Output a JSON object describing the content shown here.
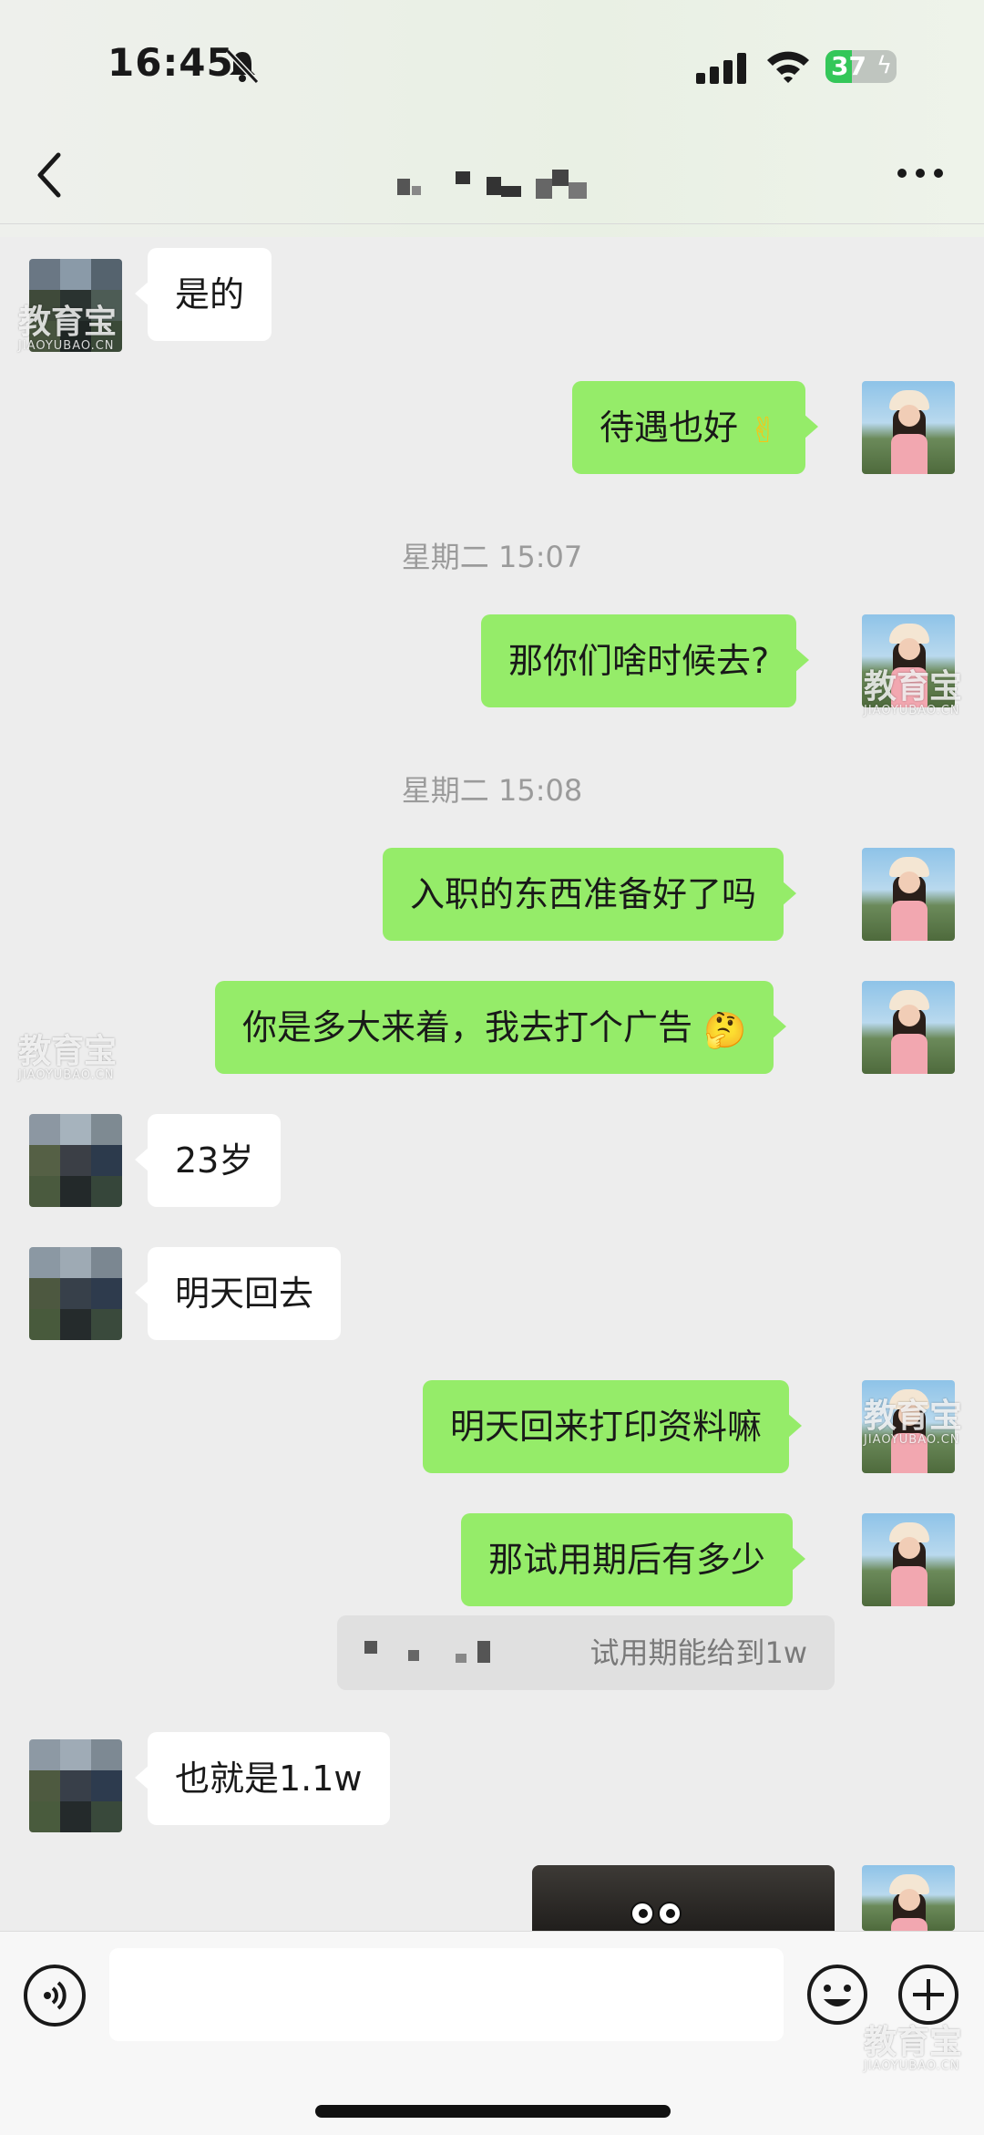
{
  "status_bar": {
    "time": "16:45",
    "battery": "37",
    "battery_level": 0.37,
    "icons": [
      "bell-mute-icon",
      "cellular-signal-icon",
      "wifi-icon",
      "battery-charging-icon"
    ]
  },
  "nav": {
    "back_icon": "chevron-left-icon",
    "more_icon": "ellipsis-icon",
    "title_pixelated": true
  },
  "messages": [
    {
      "from": "them",
      "text": "是的"
    },
    {
      "from": "me",
      "text": "待遇也好",
      "emoji": "✌"
    },
    {
      "type": "timestamp",
      "text": "星期二 15:07"
    },
    {
      "from": "me",
      "text": "那你们啥时候去?"
    },
    {
      "type": "timestamp",
      "text": "星期二 15:08"
    },
    {
      "from": "me",
      "text": "入职的东西准备好了吗"
    },
    {
      "from": "me",
      "text": "你是多大来着，我去打个广告",
      "emoji": "🤔"
    },
    {
      "from": "them",
      "text": "23岁"
    },
    {
      "from": "them",
      "text": "明天回去"
    },
    {
      "from": "me",
      "text": "明天回来打印资料嘛"
    },
    {
      "from": "me",
      "text": "那试用期后有多少"
    },
    {
      "type": "quote",
      "text": "试用期能给到1w"
    },
    {
      "from": "them",
      "text": "也就是1.1w"
    },
    {
      "from": "me",
      "type": "image"
    }
  ],
  "watermark": {
    "text": "教育宝",
    "sub": "JIAOYUBAO.CN"
  },
  "input_bar": {
    "voice_icon": "voice-icon",
    "emoji_icon": "smiley-icon",
    "plus_icon": "plus-icon"
  },
  "colors": {
    "outgoing_bubble": "#95ec69",
    "incoming_bubble": "#ffffff",
    "background": "#ededed"
  }
}
